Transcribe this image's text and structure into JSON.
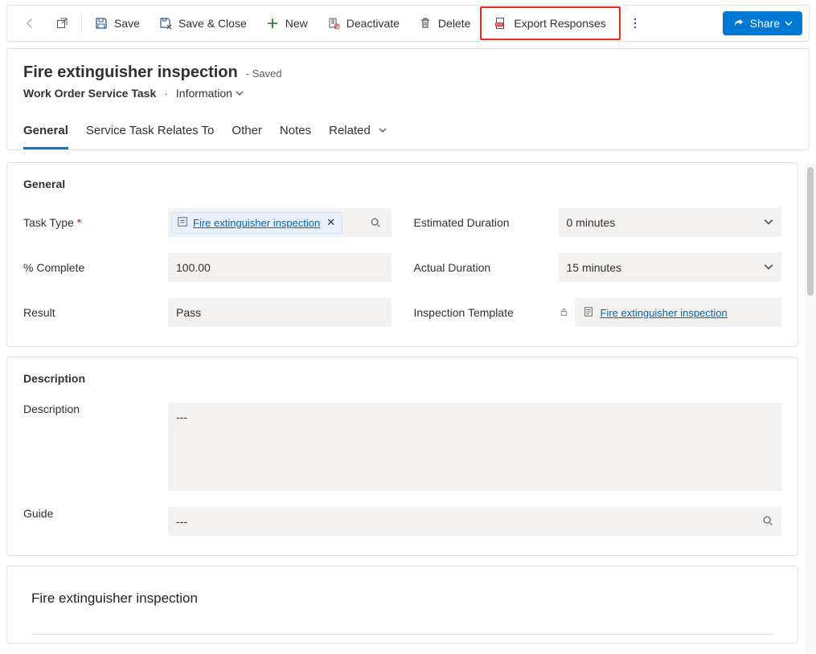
{
  "commands": {
    "save": "Save",
    "save_close": "Save & Close",
    "new": "New",
    "deactivate": "Deactivate",
    "delete": "Delete",
    "export_responses": "Export Responses",
    "share": "Share"
  },
  "header": {
    "title": "Fire extinguisher inspection",
    "saved_state": "- Saved",
    "entity": "Work Order Service Task",
    "view": "Information"
  },
  "tabs": {
    "general": "General",
    "relates": "Service Task Relates To",
    "other": "Other",
    "notes": "Notes",
    "related": "Related"
  },
  "sections": {
    "general": "General",
    "description": "Description"
  },
  "fields": {
    "task_type": {
      "label": "Task Type",
      "value": "Fire extinguisher inspection"
    },
    "estimated_duration": {
      "label": "Estimated Duration",
      "value": "0 minutes"
    },
    "percent_complete": {
      "label": "% Complete",
      "value": "100.00"
    },
    "actual_duration": {
      "label": "Actual Duration",
      "value": "15 minutes"
    },
    "result": {
      "label": "Result",
      "value": "Pass"
    },
    "inspection_template": {
      "label": "Inspection Template",
      "value": "Fire extinguisher inspection"
    },
    "description": {
      "label": "Description",
      "value": "---"
    },
    "guide": {
      "label": "Guide",
      "value": "---"
    }
  },
  "bottom": {
    "title": "Fire extinguisher inspection"
  }
}
